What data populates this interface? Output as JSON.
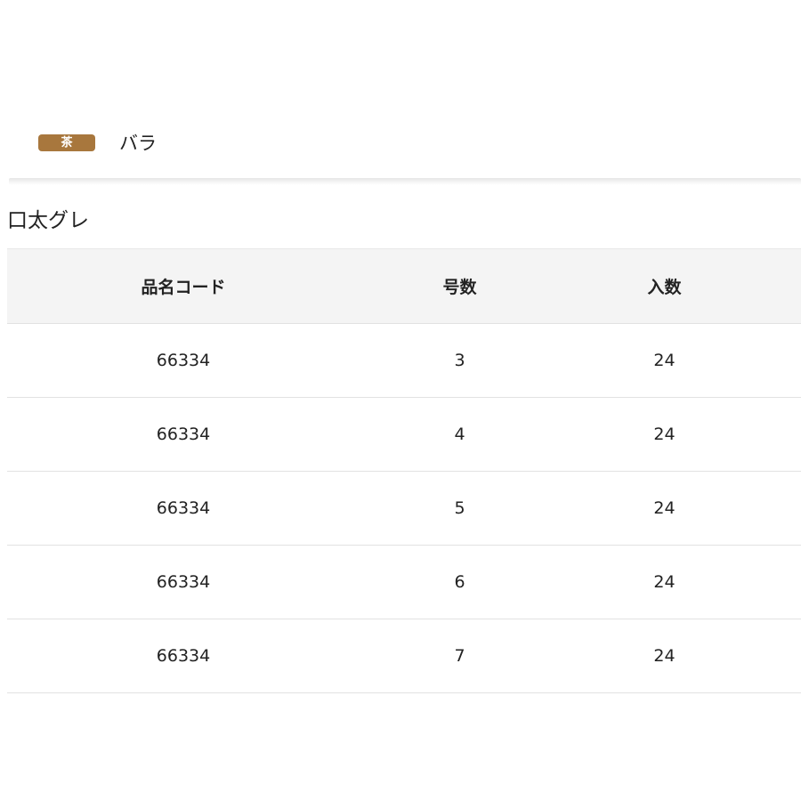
{
  "variant": {
    "color_badge": "茶",
    "color_badge_bg": "#a8773d",
    "label": "バラ"
  },
  "section": {
    "title": "口太グレ"
  },
  "table": {
    "headers": [
      "品名コード",
      "号数",
      "入数"
    ],
    "rows": [
      {
        "code": "66334",
        "size": "3",
        "qty": "24"
      },
      {
        "code": "66334",
        "size": "4",
        "qty": "24"
      },
      {
        "code": "66334",
        "size": "5",
        "qty": "24"
      },
      {
        "code": "66334",
        "size": "6",
        "qty": "24"
      },
      {
        "code": "66334",
        "size": "7",
        "qty": "24"
      }
    ]
  }
}
